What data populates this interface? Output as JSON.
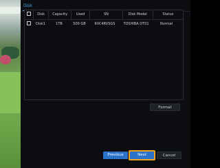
{
  "tab": {
    "label": "Disk"
  },
  "table": {
    "headers": [
      "",
      "Disk",
      "Capacity",
      "Used",
      "SN",
      "Disk Model",
      "Status"
    ],
    "rows": [
      {
        "disk": "Disk1",
        "capacity": "1TB",
        "used": "500 GB",
        "sn": "60C4RVSGS",
        "model": "TOSHIBA DT01",
        "status": "Normal"
      }
    ]
  },
  "buttons": {
    "format": "Format",
    "previous": "Previous",
    "next": "Next",
    "cancel": "Cancel"
  },
  "colors": {
    "accent": "#2b73c8",
    "focus": "#f0a21e",
    "tab": "#4aa3e6"
  }
}
